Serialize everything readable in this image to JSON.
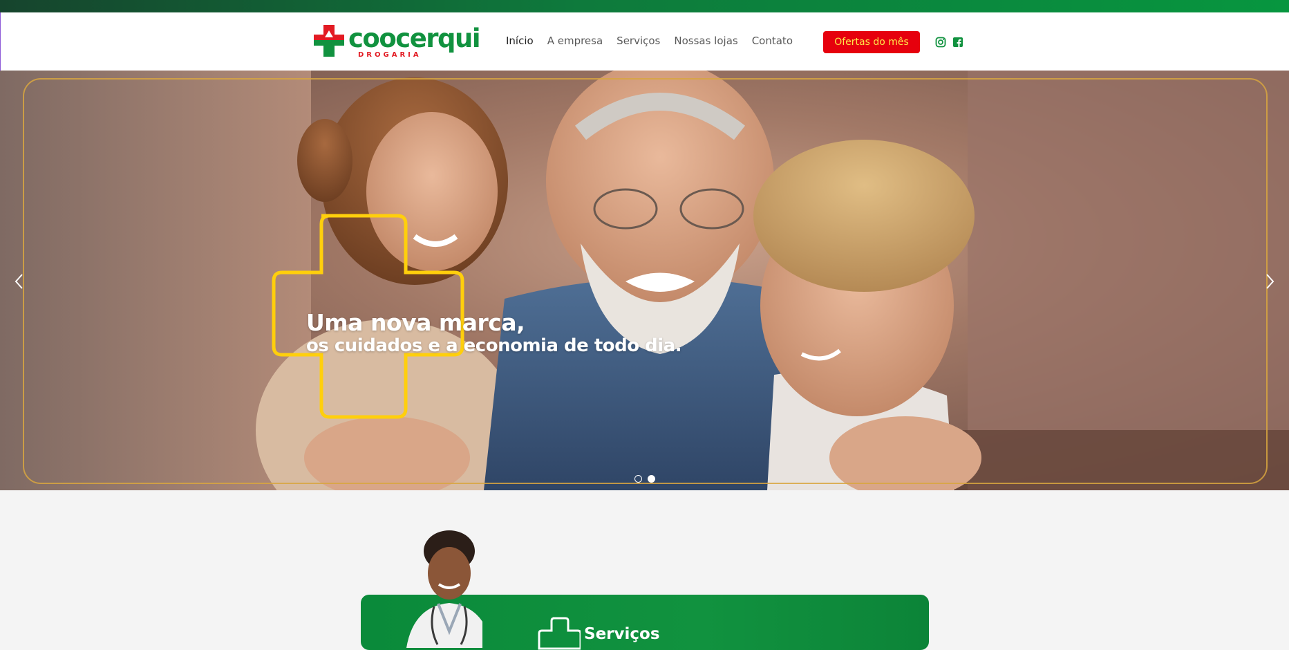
{
  "brand": {
    "name": "coocerqui",
    "subtitle": "DROGARIA",
    "green": "#11923f",
    "red": "#e21b23",
    "yellow": "#ffd200"
  },
  "nav": {
    "items": [
      {
        "label": "Início",
        "active": true
      },
      {
        "label": "A empresa",
        "active": false
      },
      {
        "label": "Serviços",
        "active": false
      },
      {
        "label": "Nossas lojas",
        "active": false
      },
      {
        "label": "Contato",
        "active": false
      }
    ]
  },
  "offers_button": {
    "label": "Ofertas do mês",
    "bg": "#e6000d",
    "color": "#ffe64a"
  },
  "social": {
    "icons": [
      "instagram-icon",
      "facebook-icon"
    ]
  },
  "hero": {
    "headline": "Uma nova marca,",
    "subline": "os cuidados e a economia de todo dia.",
    "slides_total": 2,
    "active_slide": 2
  },
  "services": {
    "title": "Serviços"
  }
}
